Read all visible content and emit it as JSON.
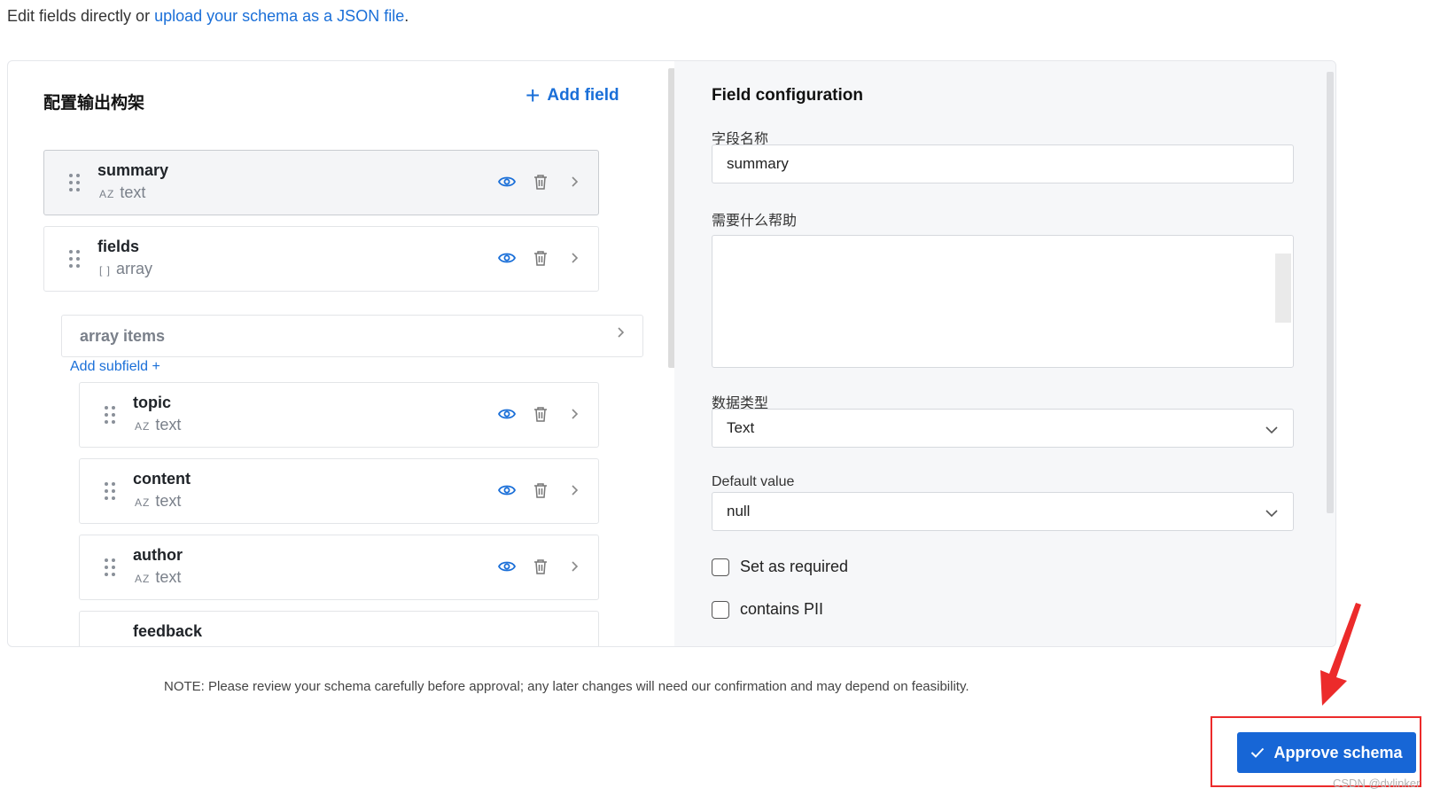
{
  "intro": {
    "prefix": "Edit fields directly or ",
    "link": "upload your schema as a JSON file",
    "suffix": "."
  },
  "left": {
    "title": "配置输出构架",
    "add_field_label": "Add field",
    "fields": [
      {
        "name": "summary",
        "type_tag": "AZ",
        "type": "text",
        "selected": true
      },
      {
        "name": "fields",
        "type_tag": "[ ]",
        "type": "array",
        "selected": false
      }
    ],
    "array_items_label": "array items",
    "add_subfield_label": "Add subfield +",
    "subfields": [
      {
        "name": "topic",
        "type_tag": "AZ",
        "type": "text"
      },
      {
        "name": "content",
        "type_tag": "AZ",
        "type": "text"
      },
      {
        "name": "author",
        "type_tag": "AZ",
        "type": "text"
      },
      {
        "name": "feedback",
        "type_tag": "",
        "type": ""
      }
    ]
  },
  "right": {
    "title": "Field configuration",
    "name_label": "字段名称",
    "name_value": "summary",
    "help_label": "需要什么帮助",
    "help_value": "",
    "type_label": "数据类型",
    "type_value": "Text",
    "default_label": "Default value",
    "default_value": "null",
    "required_label": "Set as required",
    "required_checked": false,
    "pii_label": "contains PII",
    "pii_checked": false
  },
  "note": "NOTE: Please review your schema carefully before approval; any later changes will need our confirmation and may depend on feasibility.",
  "approve_label": "Approve schema",
  "watermark": "CSDN @dvlinker",
  "colors": {
    "accent": "#1a6fd8",
    "button": "#1766d6",
    "highlight": "#ec2b2b"
  }
}
